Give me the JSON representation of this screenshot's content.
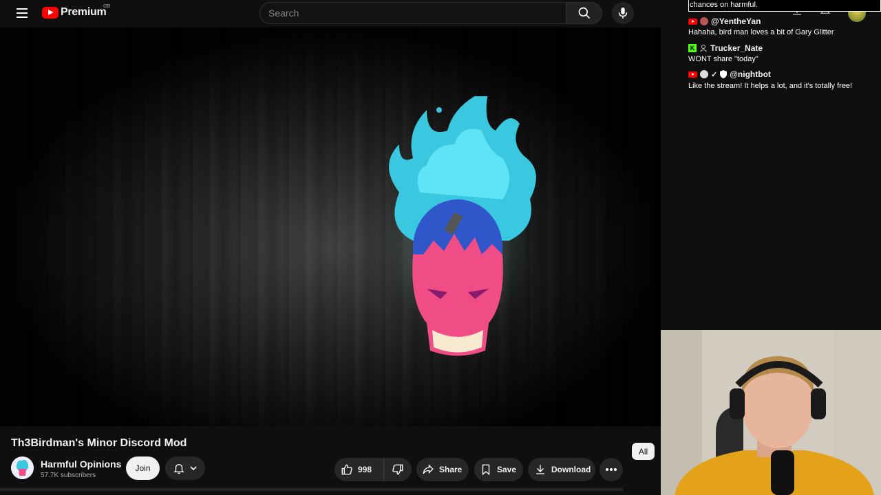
{
  "header": {
    "logo_text": "Premium",
    "region": "GB",
    "search_placeholder": "Search"
  },
  "video": {
    "title": "Th3Birdman's Minor Discord Mod"
  },
  "channel": {
    "name": "Harmful Opinions",
    "subscribers": "57.7K subscribers",
    "join_label": "Join"
  },
  "actions": {
    "likes": "998",
    "share_label": "Share",
    "save_label": "Save",
    "download_label": "Download"
  },
  "chip": {
    "all_label": "All"
  },
  "chat": {
    "top_line": "chances on harmful.",
    "messages": [
      {
        "user": "@YentheYan",
        "text": "Hahaha, bird man loves a bit of Gary Glitter",
        "platform": "youtube"
      },
      {
        "user": "Trucker_Nate",
        "text": "WONT share \"today\"",
        "platform": "kick"
      },
      {
        "user": "@nightbot",
        "text": "Like the stream! It helps a lot, and it's totally free!",
        "platform": "youtube"
      }
    ]
  },
  "colors": {
    "brand_red": "#ff0000",
    "background": "#0f0f0f",
    "button_bg": "#272727",
    "kick_green": "#53fc18"
  }
}
